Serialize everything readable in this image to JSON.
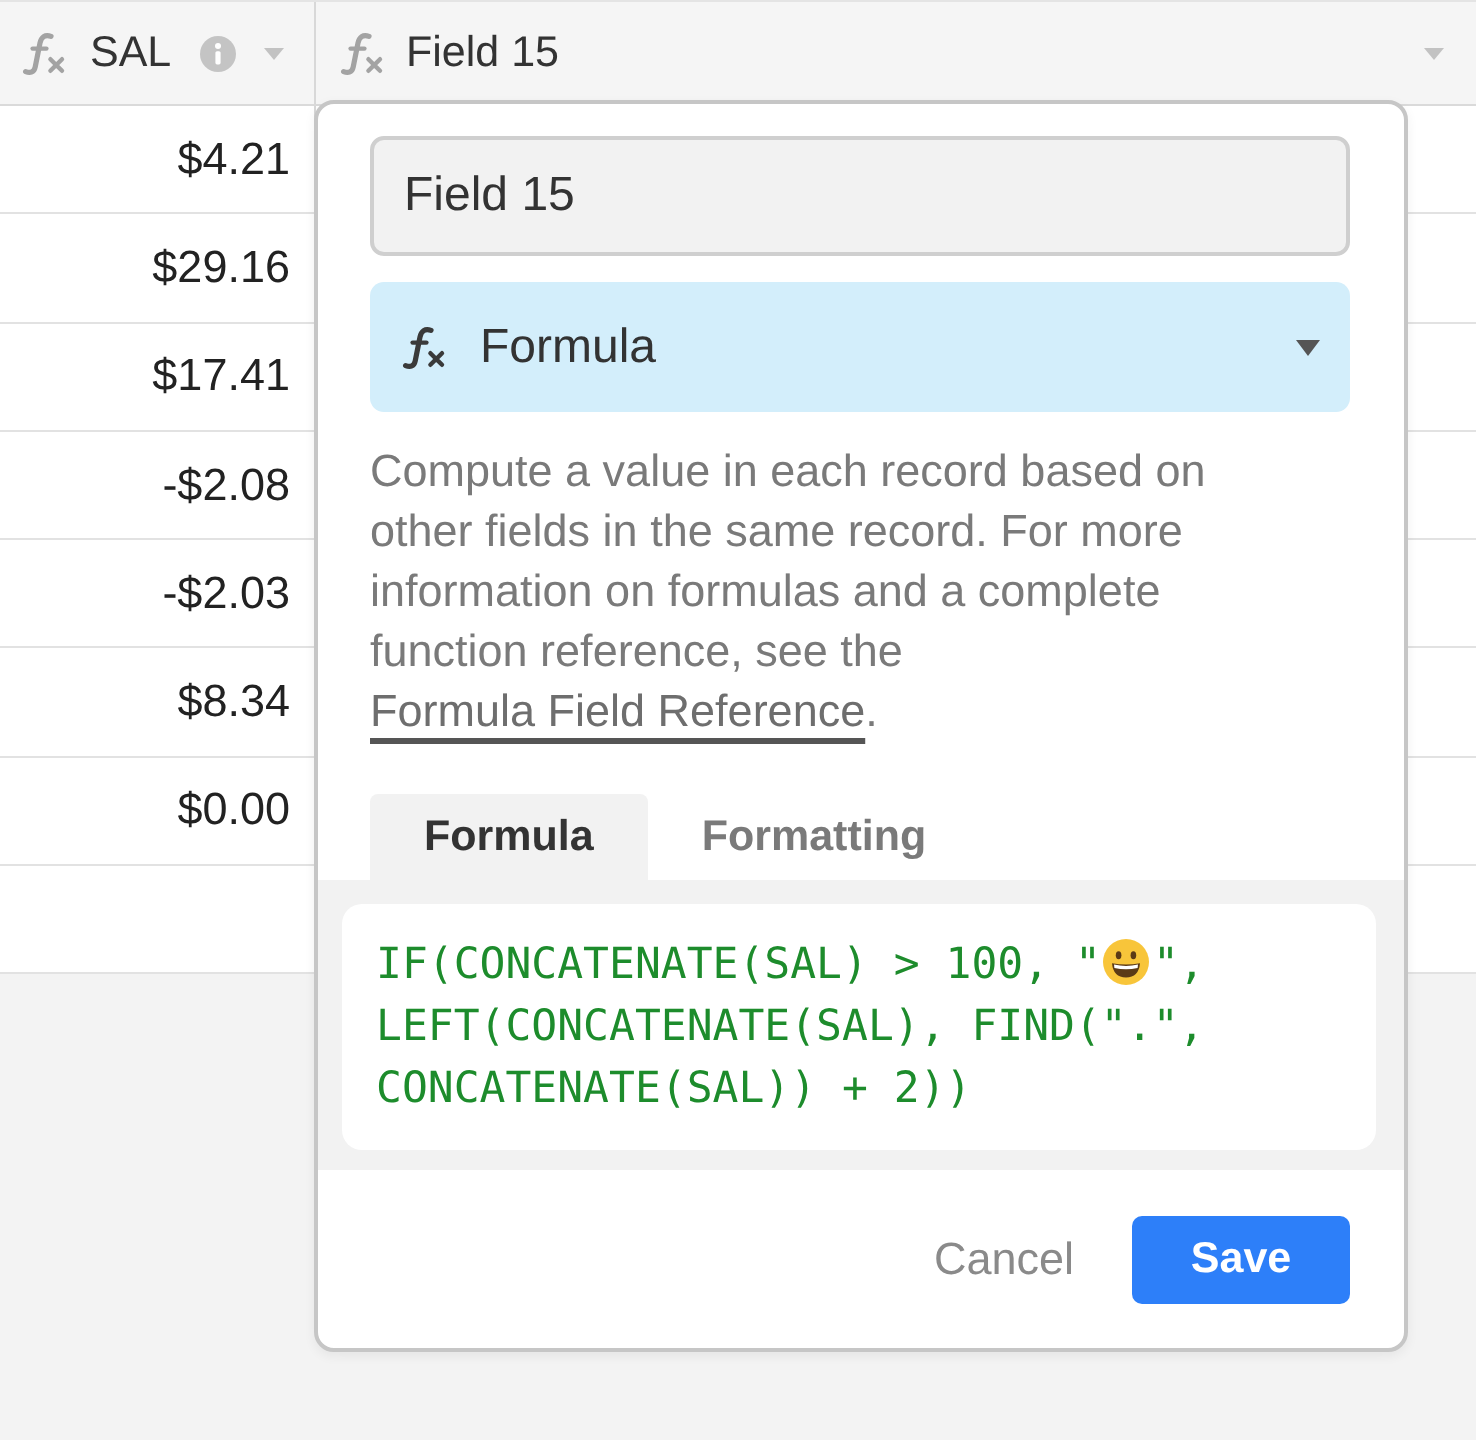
{
  "table": {
    "columns": [
      {
        "name": "SAL",
        "has_info": true
      },
      {
        "name": "Field 15",
        "has_info": false
      }
    ],
    "rows": [
      [
        "$4.21"
      ],
      [
        "$29.16"
      ],
      [
        "$17.41"
      ],
      [
        "-$2.08"
      ],
      [
        "-$2.03"
      ],
      [
        "$8.34"
      ],
      [
        "$0.00"
      ]
    ]
  },
  "field_editor": {
    "name_input": {
      "value": "Field 15"
    },
    "field_type": {
      "label": "Formula"
    },
    "description": [
      {
        "kind": "text",
        "text": "Compute a value in each record based on other fields in the same record. For more information on formulas and a complete function reference, see the "
      },
      {
        "kind": "link",
        "text": "Formula Field Reference"
      },
      {
        "kind": "text",
        "text": "."
      }
    ],
    "tabs": [
      {
        "label": "Formula",
        "selected": true
      },
      {
        "label": "Formatting",
        "selected": false
      }
    ],
    "formula": {
      "lines": [
        [
          {
            "kind": "code",
            "text": "IF(CONCATENATE(SAL) > 100, \""
          },
          {
            "kind": "emoji"
          },
          {
            "kind": "code",
            "text": "\","
          }
        ],
        [
          {
            "kind": "code",
            "text": "LEFT(CONCATENATE(SAL), FIND(\".\","
          }
        ],
        [
          {
            "kind": "code",
            "text": "CONCATENATE(SAL)) + 2))"
          }
        ]
      ]
    },
    "buttons": [
      {
        "label": "Cancel",
        "kind": "secondary"
      },
      {
        "label": "Save",
        "kind": "primary"
      }
    ]
  }
}
